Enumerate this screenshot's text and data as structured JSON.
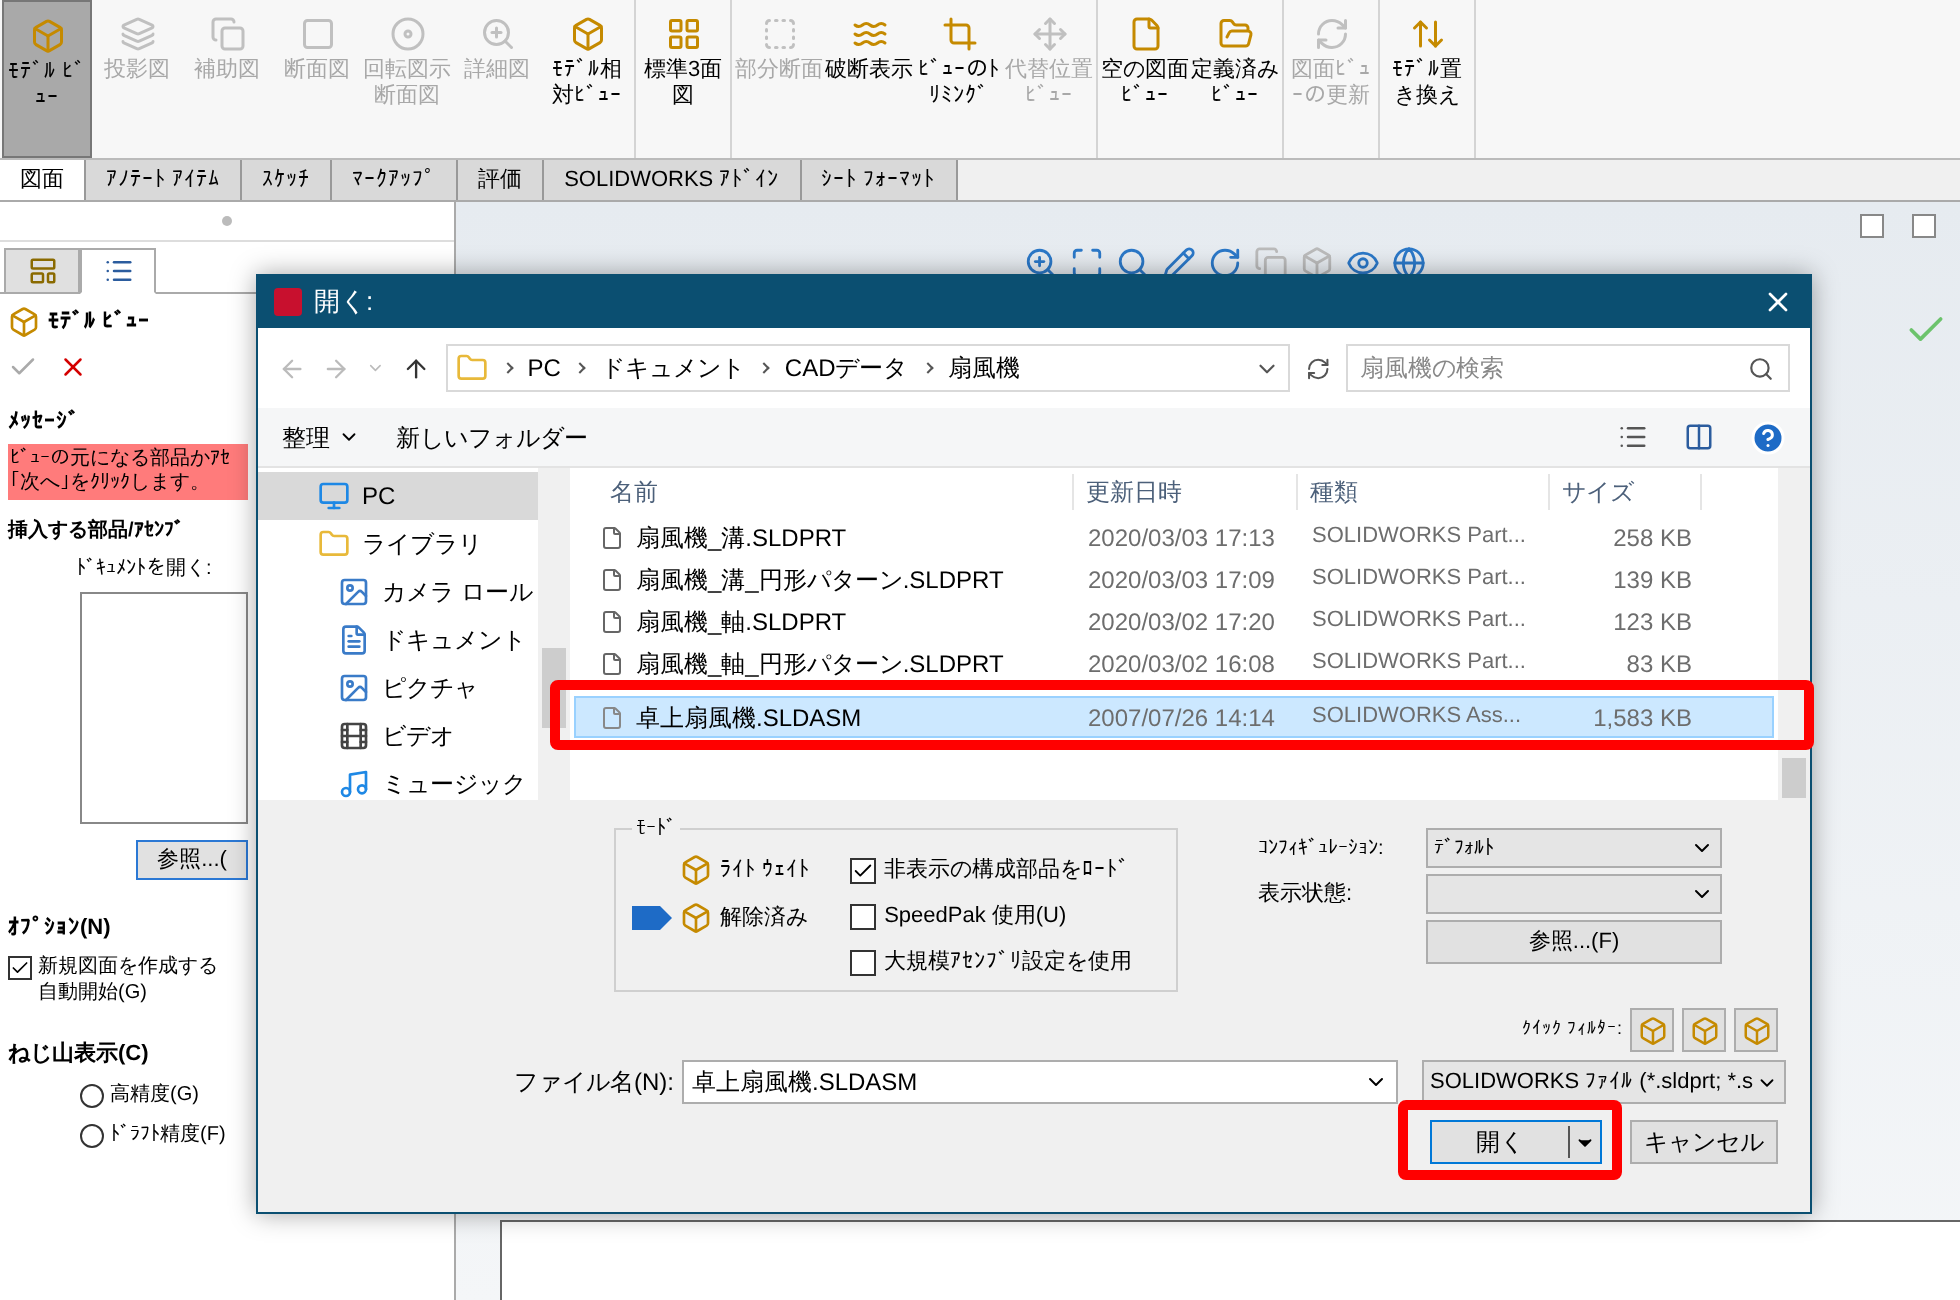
{
  "ribbon": {
    "groups": [
      {
        "items": [
          {
            "label": "ﾓﾃﾞﾙ ﾋﾞｭｰ",
            "selected": true,
            "disabled": false
          },
          {
            "label": "投影図",
            "selected": false,
            "disabled": true
          },
          {
            "label": "補助図",
            "selected": false,
            "disabled": true
          },
          {
            "label": "断面図",
            "selected": false,
            "disabled": true
          },
          {
            "label": "回転図示断面図",
            "selected": false,
            "disabled": true
          },
          {
            "label": "詳細図",
            "selected": false,
            "disabled": true
          },
          {
            "label": "ﾓﾃﾞﾙ相対ﾋﾞｭｰ",
            "selected": false,
            "disabled": false
          }
        ]
      },
      {
        "items": [
          {
            "label": "標準3面図",
            "selected": false,
            "disabled": false
          }
        ]
      },
      {
        "items": [
          {
            "label": "部分断面",
            "selected": false,
            "disabled": true
          },
          {
            "label": "破断表示",
            "selected": false,
            "disabled": false
          },
          {
            "label": "ﾋﾞｭｰのﾄﾘﾐﾝｸﾞ",
            "selected": false,
            "disabled": false
          },
          {
            "label": "代替位置ﾋﾞｭｰ",
            "selected": false,
            "disabled": true
          }
        ]
      },
      {
        "items": [
          {
            "label": "空の図面ﾋﾞｭｰ",
            "selected": false,
            "disabled": false
          },
          {
            "label": "定義済みﾋﾞｭｰ",
            "selected": false,
            "disabled": false
          }
        ]
      },
      {
        "items": [
          {
            "label": "図面ﾋﾞｭｰの更新",
            "selected": false,
            "disabled": true
          }
        ]
      },
      {
        "items": [
          {
            "label": "ﾓﾃﾞﾙ置き換え",
            "selected": false,
            "disabled": false
          }
        ]
      }
    ]
  },
  "tabs": [
    {
      "label": "図面",
      "selected": true
    },
    {
      "label": "ｱﾉﾃｰﾄ ｱｲﾃﾑ",
      "selected": false
    },
    {
      "label": "ｽｹｯﾁ",
      "selected": false
    },
    {
      "label": "ﾏｰｸｱｯﾌﾟ",
      "selected": false
    },
    {
      "label": "評価",
      "selected": false
    },
    {
      "label": "SOLIDWORKS ｱﾄﾞｲﾝ",
      "selected": false
    },
    {
      "label": "ｼｰﾄ ﾌｫｰﾏｯﾄ",
      "selected": false
    }
  ],
  "property_panel": {
    "tabs": [
      {
        "selected": false
      },
      {
        "selected": true
      }
    ],
    "title": "ﾓﾃﾞﾙ ﾋﾞｭｰ",
    "message_heading": "ﾒｯｾｰｼﾞ",
    "message": [
      "ﾋﾞｭｰの元になる部品かｱｾ",
      "｢次へ｣をｸﾘｯｸします。"
    ],
    "insert_heading": "挿入する部品/ｱｾﾝﾌﾞ",
    "open_label": "ﾄﾞｷｭﾒﾝﾄを開く:",
    "browse_button": "参照...(",
    "options_heading": "ｵﾌﾟｼｮﾝ(N)",
    "option": {
      "label": "新規図面を作成する",
      "label_2": "自動開始(G)",
      "checked": true
    },
    "thread_heading": "ねじ山表示(C)",
    "thread_options": [
      {
        "label": "高精度(G)",
        "selected": false
      },
      {
        "label": "ﾄﾞﾗﾌﾄ精度(F)",
        "selected": false
      }
    ]
  },
  "dialog": {
    "title": "開く:",
    "path": [
      "PC",
      "ドキュメント",
      "CADデータ",
      "扇風機"
    ],
    "search": {
      "placeholder": "扇風機の検索"
    },
    "toolbar": {
      "organize": "整理",
      "new_folder": "新しいフォルダー"
    },
    "nav": [
      {
        "label": "PC",
        "selected": true
      },
      {
        "label": "ライブラリ",
        "selected": false,
        "children": [
          {
            "label": "カメラ ロール",
            "selected": false
          },
          {
            "label": "ドキュメント",
            "selected": false
          },
          {
            "label": "ピクチャ",
            "selected": false
          },
          {
            "label": "ビデオ",
            "selected": false
          },
          {
            "label": "ミュージック",
            "selected": false
          }
        ]
      }
    ],
    "columns": [
      "名前",
      "更新日時",
      "種類",
      "サイズ"
    ],
    "rows": [
      {
        "name": "扇風機_溝.SLDPRT",
        "date": "2020/03/03 17:13",
        "type": "SOLIDWORKS Part...",
        "size": "258 KB",
        "selected": false
      },
      {
        "name": "扇風機_溝_円形パターン.SLDPRT",
        "date": "2020/03/03 17:09",
        "type": "SOLIDWORKS Part...",
        "size": "139 KB",
        "selected": false
      },
      {
        "name": "扇風機_軸.SLDPRT",
        "date": "2020/03/02 17:20",
        "type": "SOLIDWORKS Part...",
        "size": "123 KB",
        "selected": false
      },
      {
        "name": "扇風機_軸_円形パターン.SLDPRT",
        "date": "2020/03/02 16:08",
        "type": "SOLIDWORKS Part...",
        "size": "83 KB",
        "selected": false
      },
      {
        "name": "卓上扇風機.SLDASM",
        "date": "2007/07/26 14:14",
        "type": "SOLIDWORKS Ass...",
        "size": "1,583 KB",
        "selected": true
      }
    ],
    "mode": {
      "legend": "ﾓｰﾄﾞ",
      "options": [
        {
          "label": "ﾗｲﾄ ｳｪｲﾄ",
          "selected": false
        },
        {
          "label": "解除済み",
          "selected": true
        }
      ],
      "checkboxes": [
        {
          "label": "非表示の構成部品をﾛｰﾄﾞ",
          "checked": true
        },
        {
          "label": "SpeedPak 使用(U)",
          "checked": false
        },
        {
          "label": "大規模ｱｾﾝﾌﾞﾘ設定を使用",
          "checked": false
        }
      ]
    },
    "config_label": "ｺﾝﾌｨｷﾞｭﾚｰｼｮﾝ:",
    "config_value": "ﾃﾞﾌｫﾙﾄ",
    "display_label": "表示状態:",
    "browse_button": "参照...(F)",
    "quick_filter": "ｸｲｯｸ ﾌｨﾙﾀｰ:",
    "filename_label": "ファイル名(N):",
    "filename": "卓上扇風機.SLDASM",
    "filetype": "SOLIDWORKS ﾌｧｲﾙ (*.sldprt; *.s",
    "open_button": "開く",
    "cancel_button": "キャンセル"
  }
}
